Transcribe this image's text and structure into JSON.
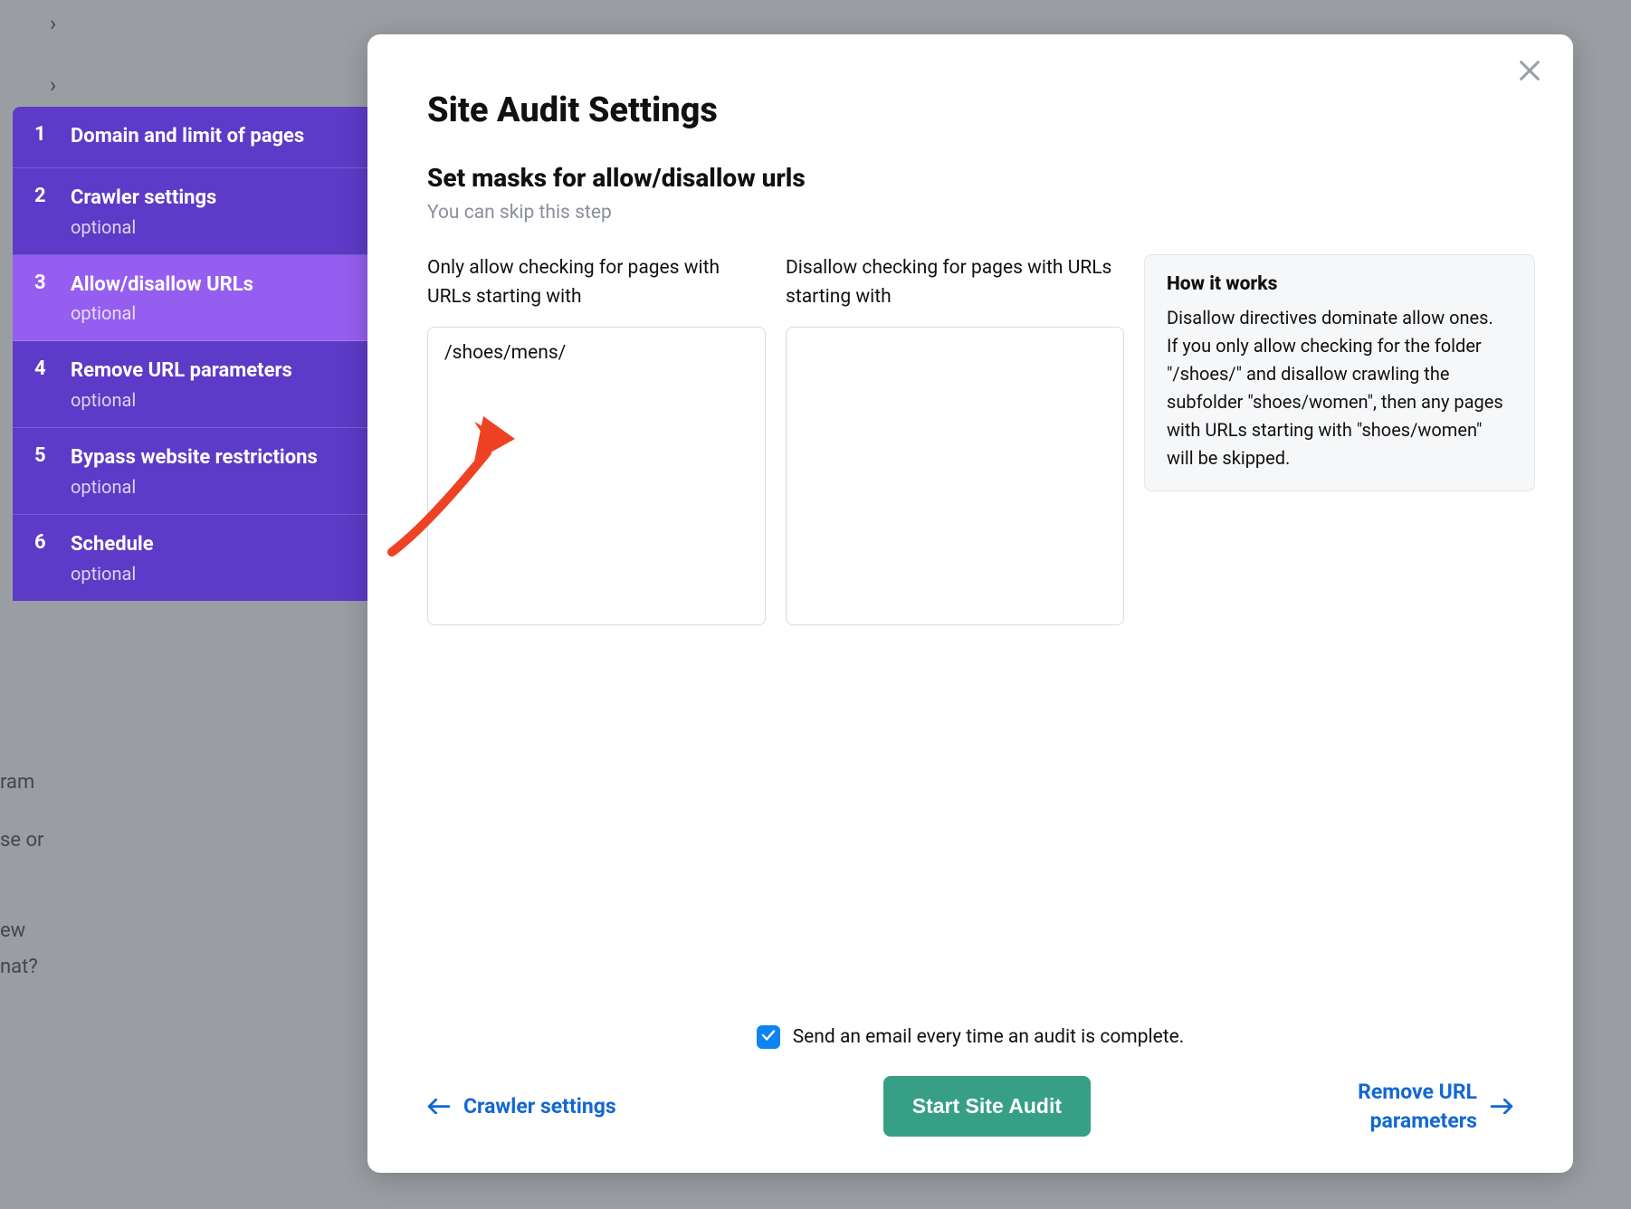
{
  "modal": {
    "title": "Site Audit Settings",
    "section_title": "Set masks for allow/disallow urls",
    "section_sub": "You can skip this step",
    "allow_label": "Only allow checking for pages with URLs starting with",
    "disallow_label": "Disallow checking for pages with URLs starting with",
    "allow_value": "/shoes/mens/",
    "disallow_value": "",
    "info_title": "How it works",
    "info_body": "Disallow directives dominate allow ones.\nIf you only allow checking for the folder \"/shoes/\" and disallow crawling the subfolder \"shoes/women\", then any pages with URLs starting with \"shoes/women\" will be skipped.",
    "email_label": "Send an email every time an audit is complete.",
    "back_label": "Crawler settings",
    "next_label": "Remove URL\nparameters",
    "primary_label": "Start Site Audit"
  },
  "sidebar": {
    "optional_label": "optional",
    "steps": [
      {
        "num": "1",
        "title": "Domain and limit of pages",
        "optional": false
      },
      {
        "num": "2",
        "title": "Crawler settings",
        "optional": true
      },
      {
        "num": "3",
        "title": "Allow/disallow URLs",
        "optional": true
      },
      {
        "num": "4",
        "title": "Remove URL parameters",
        "optional": true
      },
      {
        "num": "5",
        "title": "Bypass website restrictions",
        "optional": true
      },
      {
        "num": "6",
        "title": "Schedule",
        "optional": true
      }
    ]
  },
  "bg": {
    "frag1": "ram",
    "frag2": "se or",
    "frag3": "ew",
    "frag4": "nat?"
  }
}
